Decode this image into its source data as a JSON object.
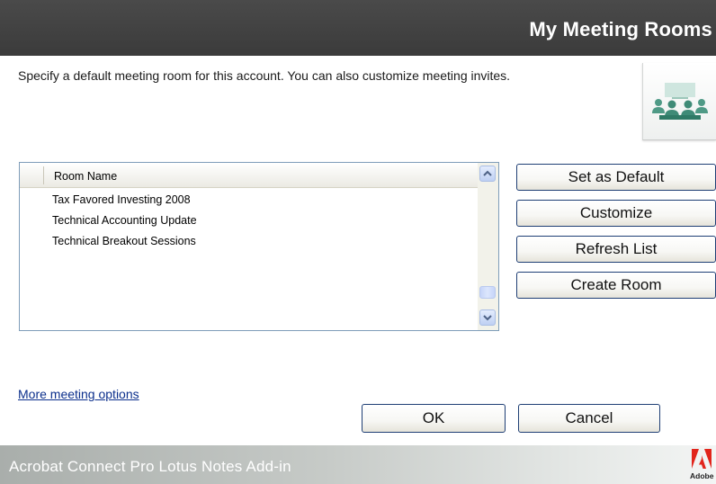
{
  "header": {
    "title": "My Meeting Rooms"
  },
  "description": "Specify a default meeting room for this account.  You can also customize meeting invites.",
  "room_list": {
    "column_header": "Room Name",
    "rows": [
      "Tax Favored Investing 2008",
      "Technical Accounting Update",
      "Technical Breakout Sessions"
    ]
  },
  "side_buttons": {
    "set_default": "Set as Default",
    "customize": "Customize",
    "refresh": "Refresh List",
    "create": "Create Room"
  },
  "more_options_link": "More meeting options",
  "dialog_buttons": {
    "ok": "OK",
    "cancel": "Cancel"
  },
  "footer": {
    "product_name": "Acrobat Connect Pro Lotus Notes Add-in",
    "brand": "Adobe"
  },
  "icons": {
    "meeting": "meeting-room-icon",
    "scroll_up": "chevron-up-icon",
    "scroll_down": "chevron-down-icon",
    "brand": "adobe-logo-icon"
  },
  "colors": {
    "header_bg": "#404040",
    "icon_green": "#4f9a86",
    "link": "#0b2f8c",
    "button_border": "#1f3f75",
    "adobe_red": "#e1251b"
  }
}
